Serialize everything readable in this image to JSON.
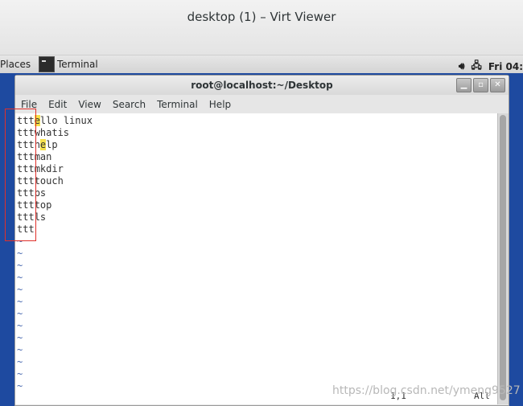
{
  "viewer": {
    "title": "desktop (1) – Virt Viewer"
  },
  "panel": {
    "places": "Places",
    "terminal": "Terminal",
    "clock": "Fri 04:"
  },
  "terminal": {
    "title": "root@localhost:~/Desktop",
    "menus": [
      "File",
      "Edit",
      "View",
      "Search",
      "Terminal",
      "Help"
    ],
    "lines": [
      {
        "prefix": "ttt",
        "hl": "e",
        "rest": "llo linux",
        "post": ""
      },
      {
        "prefix": "ttt",
        "hl": "",
        "rest": "whatis",
        "post": ""
      },
      {
        "prefix": "ttt",
        "hl": "",
        "rest": "h",
        "post": ""
      },
      {
        "prefix": "ttt",
        "hl": "",
        "rest": "man",
        "post": ""
      },
      {
        "prefix": "ttt",
        "hl": "",
        "rest": "mkdir",
        "post": ""
      },
      {
        "prefix": "ttt",
        "hl": "",
        "rest": "touch",
        "post": ""
      },
      {
        "prefix": "ttt",
        "hl": "",
        "rest": "ps",
        "post": ""
      },
      {
        "prefix": "ttt",
        "hl": "",
        "rest": "top",
        "post": ""
      },
      {
        "prefix": "ttt",
        "hl": "",
        "rest": "ls",
        "post": ""
      },
      {
        "prefix": "ttt",
        "hl": "",
        "rest": "",
        "post": ""
      }
    ],
    "line1": {
      "prefix": "ttt",
      "hl": "e",
      "rest": "llo linux"
    },
    "line2": {
      "prefix": "ttt",
      "rest": "whatis"
    },
    "line3": {
      "prefix": "ttt",
      "pre": "h",
      "hl": "e",
      "rest": "lp"
    },
    "line4": {
      "prefix": "ttt",
      "rest": "man"
    },
    "line5": {
      "prefix": "ttt",
      "rest": "mkdir"
    },
    "line6": {
      "prefix": "ttt",
      "rest": "touch"
    },
    "line7": {
      "prefix": "ttt",
      "rest": "ps"
    },
    "line8": {
      "prefix": "ttt",
      "rest": "top"
    },
    "line9": {
      "prefix": "ttt",
      "rest": "ls"
    },
    "line10": {
      "prefix": "ttt"
    },
    "tilde": "~",
    "status_pos": "1,1",
    "status_all": "All"
  },
  "watermark": "https://blog.csdn.net/ymeng9527"
}
